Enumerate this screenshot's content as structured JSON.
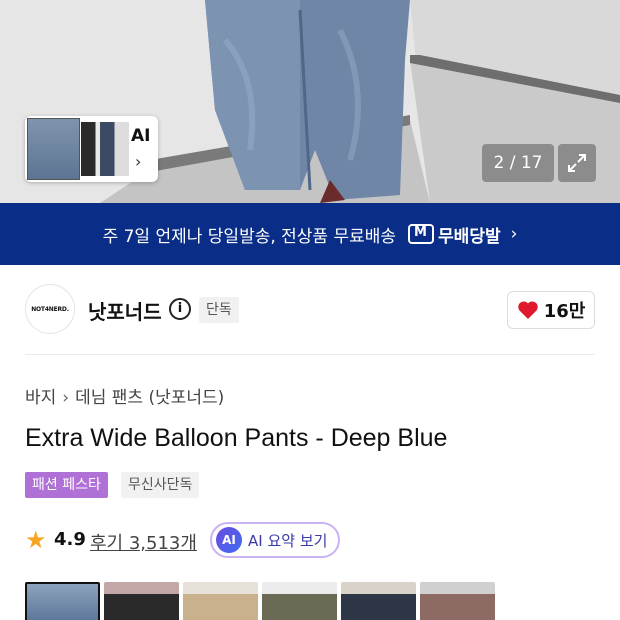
{
  "hero": {
    "ai_thumb_label": "AI",
    "image_counter": "2 / 17"
  },
  "banner": {
    "text": "주 7일 언제나 당일발송, 전상품 무료배송",
    "logo_text": "무배당발"
  },
  "brand": {
    "logo_text": "NOT4NERD.",
    "name": "낫포너드",
    "tag": "단독",
    "like_count": "16만"
  },
  "breadcrumb": [
    "바지",
    "데님 팬츠 (낫포너드)"
  ],
  "product": {
    "title": "Extra Wide Balloon Pants - Deep Blue",
    "tags": [
      "패션 페스타",
      "무신사단독"
    ],
    "rating": "4.9",
    "reviews": "후기 3,513개",
    "ai_summary_badge": "AI",
    "ai_summary_label": "AI 요약 보기"
  },
  "colors": {
    "banner_bg": "#0a2d87",
    "festa_tag": "#b071d6",
    "heart": "#e0192c",
    "star": "#f5a623"
  }
}
